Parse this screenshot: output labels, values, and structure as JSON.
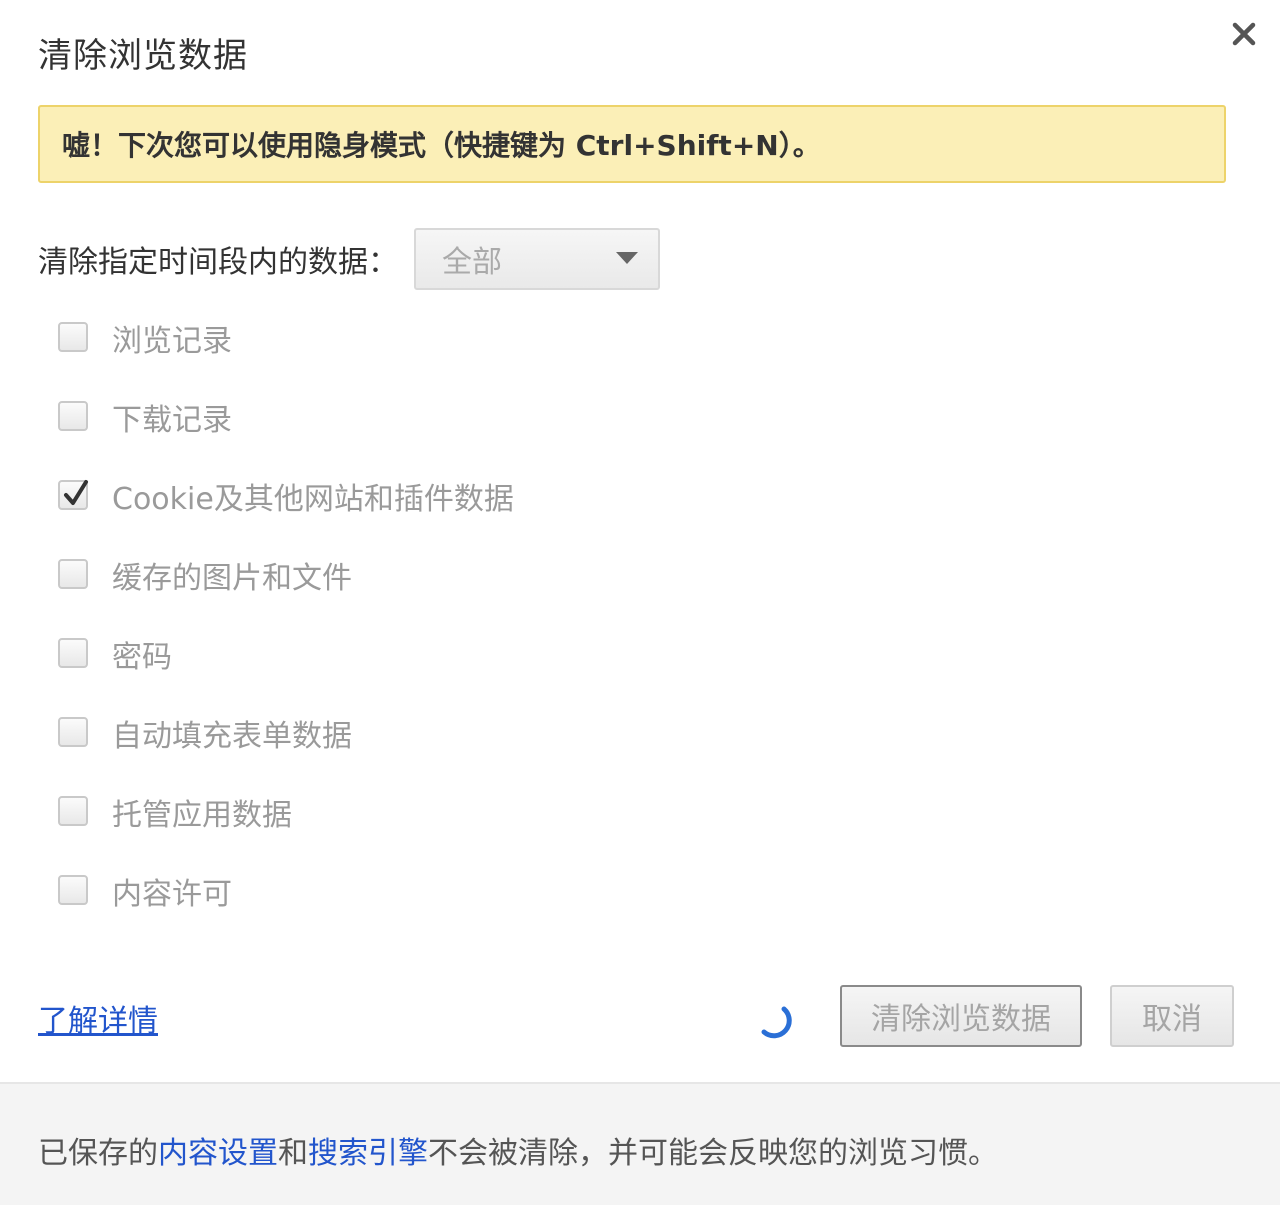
{
  "dialog": {
    "title": "清除浏览数据",
    "close_icon": "close-icon"
  },
  "notice": {
    "text": "嘘！下次您可以使用隐身模式（快捷键为 Ctrl+Shift+N）。"
  },
  "range": {
    "label": "清除指定时间段内的数据：",
    "selected": "全部",
    "dropdown_icon": "chevron-down-icon"
  },
  "options": [
    {
      "label": "浏览记录",
      "checked": false
    },
    {
      "label": "下载记录",
      "checked": false
    },
    {
      "label": "Cookie及其他网站和插件数据",
      "checked": true
    },
    {
      "label": "缓存的图片和文件",
      "checked": false
    },
    {
      "label": "密码",
      "checked": false
    },
    {
      "label": "自动填充表单数据",
      "checked": false
    },
    {
      "label": "托管应用数据",
      "checked": false
    },
    {
      "label": "内容许可",
      "checked": false
    }
  ],
  "actions": {
    "learn_more": "了解详情",
    "clear_button": "清除浏览数据",
    "cancel_button": "取消",
    "spinner_icon": "loading-spinner-icon"
  },
  "footer": {
    "prefix": "已保存的",
    "link1": "内容设置",
    "middle": "和",
    "link2": "搜索引擎",
    "suffix": "不会被清除，并可能会反映您的浏览习惯。"
  },
  "colors": {
    "notice_bg": "#fbefb7",
    "notice_border": "#edd36a",
    "link": "#2255cc",
    "spinner": "#2a6fd6"
  }
}
